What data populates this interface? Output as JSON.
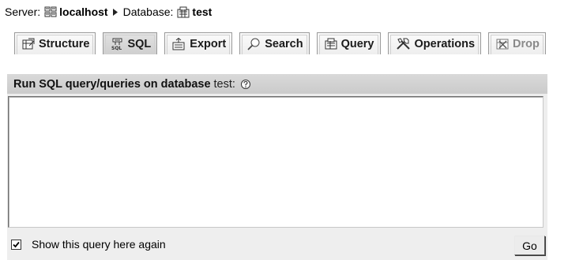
{
  "breadcrumb": {
    "server_label": "Server:",
    "server_value": "localhost",
    "database_label": "Database:",
    "database_value": "test"
  },
  "tabs": [
    {
      "label": "Structure",
      "icon": "structure-icon"
    },
    {
      "label": "SQL",
      "icon": "sql-icon",
      "active": true
    },
    {
      "label": "Export",
      "icon": "export-icon"
    },
    {
      "label": "Search",
      "icon": "search-icon"
    },
    {
      "label": "Query",
      "icon": "query-icon"
    },
    {
      "label": "Operations",
      "icon": "operations-icon"
    },
    {
      "label": "Drop",
      "icon": "drop-icon",
      "dimmed": true
    }
  ],
  "sql_panel": {
    "heading": "Run SQL query/queries on database",
    "database": "test:",
    "help_icon": "help-icon",
    "query_value": "",
    "show_again_label": "Show this query here again",
    "show_again_checked": true,
    "go_label": "Go"
  },
  "colors": {
    "panel_background": "#eeeeee",
    "panel_header": "#d0d0d0",
    "tab_border": "#9a9a9a"
  }
}
